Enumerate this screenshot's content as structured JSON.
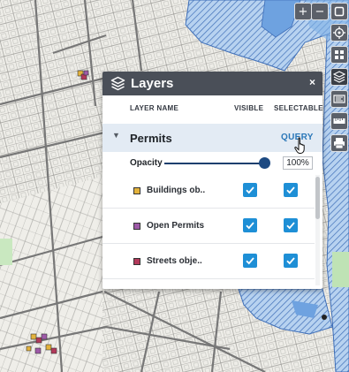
{
  "panel": {
    "title": "Layers",
    "close_label": "×",
    "columns": {
      "layer_name": "LAYER NAME",
      "visible": "VISIBLE",
      "selectable": "SELECTABLE"
    },
    "group": {
      "name": "Permits",
      "expanded": true,
      "action": "QUERY"
    },
    "opacity": {
      "label": "Opacity",
      "value_text": "100%",
      "value": 1.0
    },
    "layers": [
      {
        "name": "Buildings ob..",
        "swatch_color": "#e3b23c",
        "visible": true,
        "selectable": true
      },
      {
        "name": "Open Permits",
        "swatch_color": "#9e5aa8",
        "visible": true,
        "selectable": true
      },
      {
        "name": "Streets obje..",
        "swatch_color": "#b2395a",
        "visible": true,
        "selectable": true
      }
    ]
  },
  "toolbar": {
    "zoom_in": "+",
    "zoom_out": "−",
    "buttons": [
      "panel-icon",
      "locate-icon",
      "basemap-icon",
      "layers-icon",
      "measure-icon",
      "ruler-icon",
      "print-icon"
    ]
  },
  "colors": {
    "header_bg": "#4a4f58",
    "accent": "#2a77b8",
    "checkbox": "#1e8fd6",
    "water_fill": "#a8c9ee",
    "water_stroke": "#3f6fb8"
  }
}
